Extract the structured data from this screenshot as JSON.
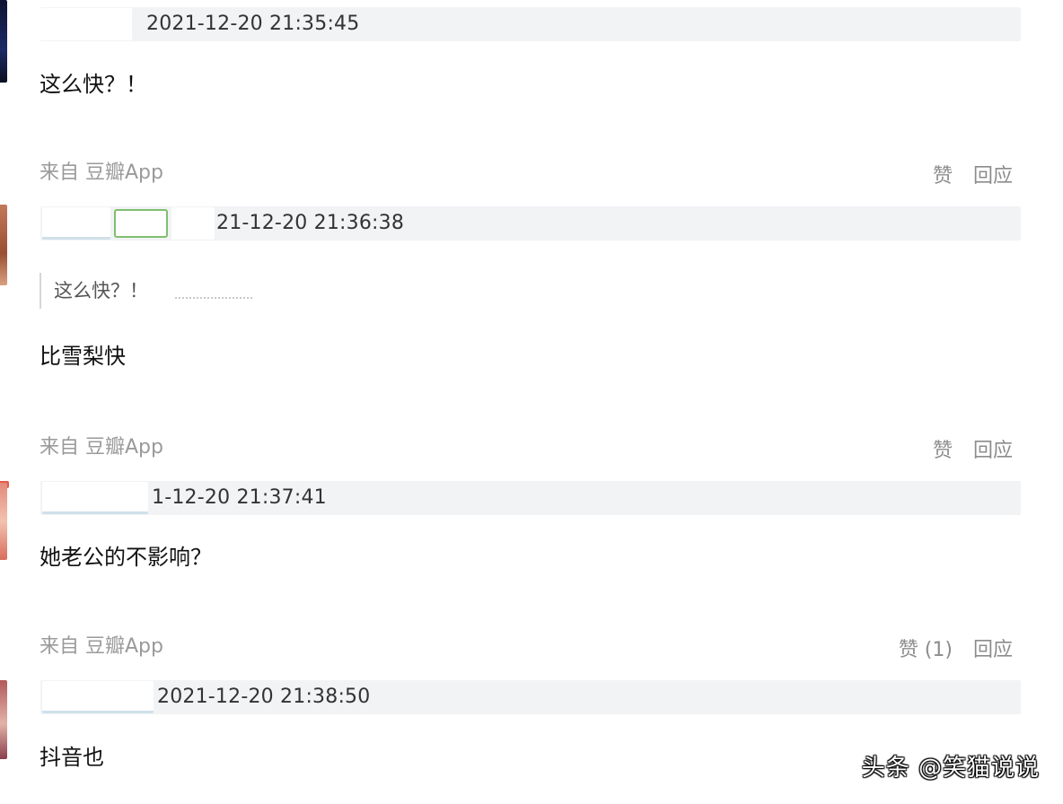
{
  "comments": [
    {
      "timestamp": "2021-12-20 21:35:45",
      "body": "这么快？！",
      "source": "来自 豆瓣App",
      "like_label": "赞",
      "reply_label": "回应"
    },
    {
      "timestamp": "21-12-20 21:36:38",
      "quote": "这么快？！",
      "body": "比雪梨快",
      "source": "来自 豆瓣App",
      "like_label": "赞",
      "reply_label": "回应"
    },
    {
      "timestamp": "1-12-20 21:37:41",
      "body": "她老公的不影响？",
      "source": "来自 豆瓣App",
      "like_label": "赞 (1)",
      "reply_label": "回应"
    },
    {
      "timestamp": "2021-12-20 21:38:50",
      "body": "抖音也"
    }
  ],
  "watermark": "头条 @笑猫说说",
  "colors": {
    "meta_bar": "#f1f3f5",
    "source_text": "#9a9a9a",
    "action_text": "#8c8c8c"
  }
}
